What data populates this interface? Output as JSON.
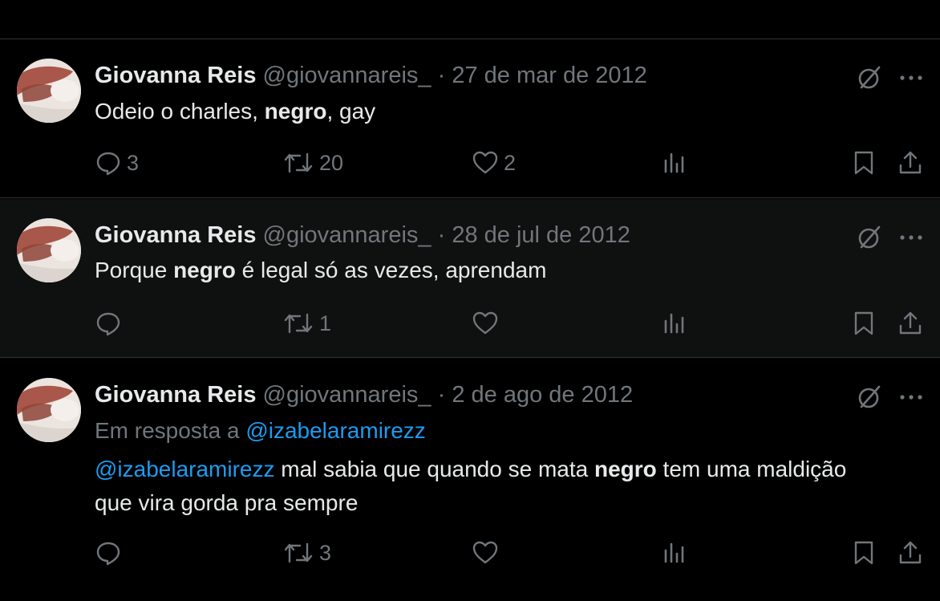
{
  "tweets": [
    {
      "name": "Giovanna Reis",
      "handle": "@giovannareis_",
      "separator": "·",
      "date": "27 de mar de 2012",
      "text_parts": [
        "Odeio o charles, ",
        "negro",
        ", gay"
      ],
      "replies": "3",
      "retweets": "20",
      "likes": "2"
    },
    {
      "name": "Giovanna Reis",
      "handle": "@giovannareis_",
      "separator": "·",
      "date": "28 de jul de 2012",
      "text_parts": [
        "Porque ",
        "negro",
        " é legal só as vezes, aprendam"
      ],
      "replies": "",
      "retweets": "1",
      "likes": ""
    },
    {
      "name": "Giovanna Reis",
      "handle": "@giovannareis_",
      "separator": "·",
      "date": "2 de ago de 2012",
      "reply_prefix": "Em resposta a ",
      "reply_to": "@izabelaramirezz",
      "mention": "@izabelaramirezz",
      "text_parts": [
        " mal sabia que quando se mata ",
        "negro",
        " tem uma maldição"
      ],
      "text_line2": "que vira gorda pra sempre",
      "replies": "",
      "retweets": "3",
      "likes": ""
    }
  ],
  "colors": {
    "background": "#000000",
    "muted": "#71767b",
    "text": "#e7e9ea",
    "link": "#1d9bf0",
    "divider": "#2f3336"
  },
  "icons": [
    "avatar",
    "grok-icon",
    "more-icon",
    "reply-icon",
    "retweet-icon",
    "like-icon",
    "views-icon",
    "bookmark-icon",
    "share-icon"
  ]
}
